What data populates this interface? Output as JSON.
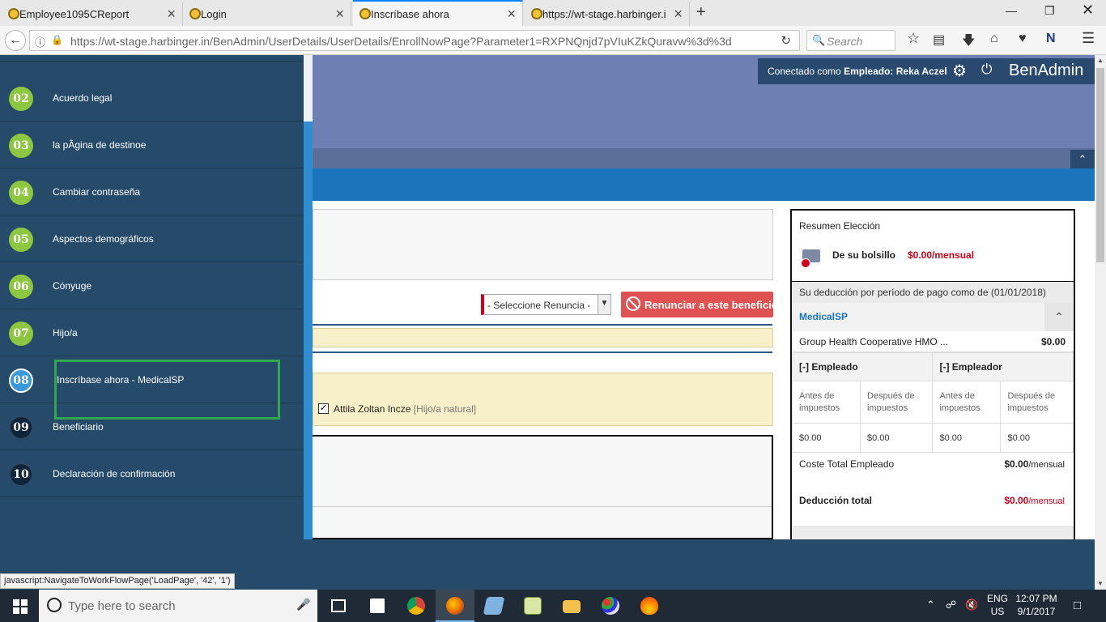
{
  "browser": {
    "tabs": [
      {
        "title": "Employee1095CReport",
        "close": "×"
      },
      {
        "title": "Login",
        "close": "×"
      },
      {
        "title": "Inscríbase ahora",
        "close": "×"
      },
      {
        "title": "https://wt-stage.harbinger.i",
        "close": "×"
      }
    ],
    "new_tab": "+",
    "url": "https://wt-stage.harbinger.in/BenAdmin/UserDetails/UserDetails/EnrollNowPage?Parameter1=RXPNQnjd7pVIuKZkQuravw%3d%3d",
    "search_placeholder": "Search"
  },
  "header": {
    "logged_prefix": "Conectado como",
    "logged_role": "Empleado:",
    "logged_user": "Reka Aczel",
    "brand": "BenAdmin"
  },
  "sidebar": {
    "steps": [
      {
        "num": "02",
        "label": "Acuerdo legal",
        "state": "done"
      },
      {
        "num": "03",
        "label": "la pÃgina de destinoe",
        "state": "done"
      },
      {
        "num": "04",
        "label": "Cambiar contraseña",
        "state": "done"
      },
      {
        "num": "05",
        "label": "Aspectos demográficos",
        "state": "done"
      },
      {
        "num": "06",
        "label": "Cónyuge",
        "state": "done"
      },
      {
        "num": "07",
        "label": "Hijo/a",
        "state": "done"
      },
      {
        "num": "08",
        "label": "Inscríbase ahora - MedicalSP",
        "state": "current"
      },
      {
        "num": "09",
        "label": "Beneficiario",
        "state": "pending"
      },
      {
        "num": "10",
        "label": "Declaración de confirmación",
        "state": "pending"
      }
    ]
  },
  "enroll": {
    "waive_select": "- Seleccione Renuncia -",
    "waive_button": "Renunciar a este beneficio",
    "dependent_name": "Attila Zoltan Incze",
    "dependent_relation": "[Hijo/a natural]"
  },
  "summary": {
    "title": "Resumen Elección",
    "pocket_label": "De su bolsillo",
    "pocket_value": "$0.00/mensual",
    "deduction_period": "Su deducción por período de pago como de (01/01/2018)",
    "plan_name": "MedicalSP",
    "carrier_name": "Group Health Cooperative HMO ...",
    "carrier_value": "$0.00",
    "employee_header": "[-] Empleado",
    "employer_header": "[-] Empleador",
    "subheaders": [
      "Antes de impuestos",
      "Después de impuestos",
      "Antes de impuestos",
      "Después de impuestos"
    ],
    "values": [
      "$0.00",
      "$0.00",
      "$0.00",
      "$0.00"
    ],
    "total_employee_label": "Coste Total Empleado",
    "total_employee_amount": "$0.00",
    "total_employee_unit": "/mensual",
    "total_deduction_label": "Deducción total",
    "total_deduction_amount": "$0.00",
    "total_deduction_unit": "/mensual"
  },
  "status_url": "javascript:NavigateToWorkFlowPage('LoadPage', '42', '1')",
  "taskbar": {
    "search_placeholder": "Type here to search",
    "lang": "ENG",
    "region": "US",
    "time": "12:07 PM",
    "date": "9/1/2017"
  },
  "colors": {
    "sidebar_bg": "#254a6a",
    "step_done": "#8dc63f",
    "step_current": "#3a9ad9",
    "accent_blue": "#1b75bc",
    "danger": "#d0021b",
    "highlight_box": "#2fa84f"
  }
}
